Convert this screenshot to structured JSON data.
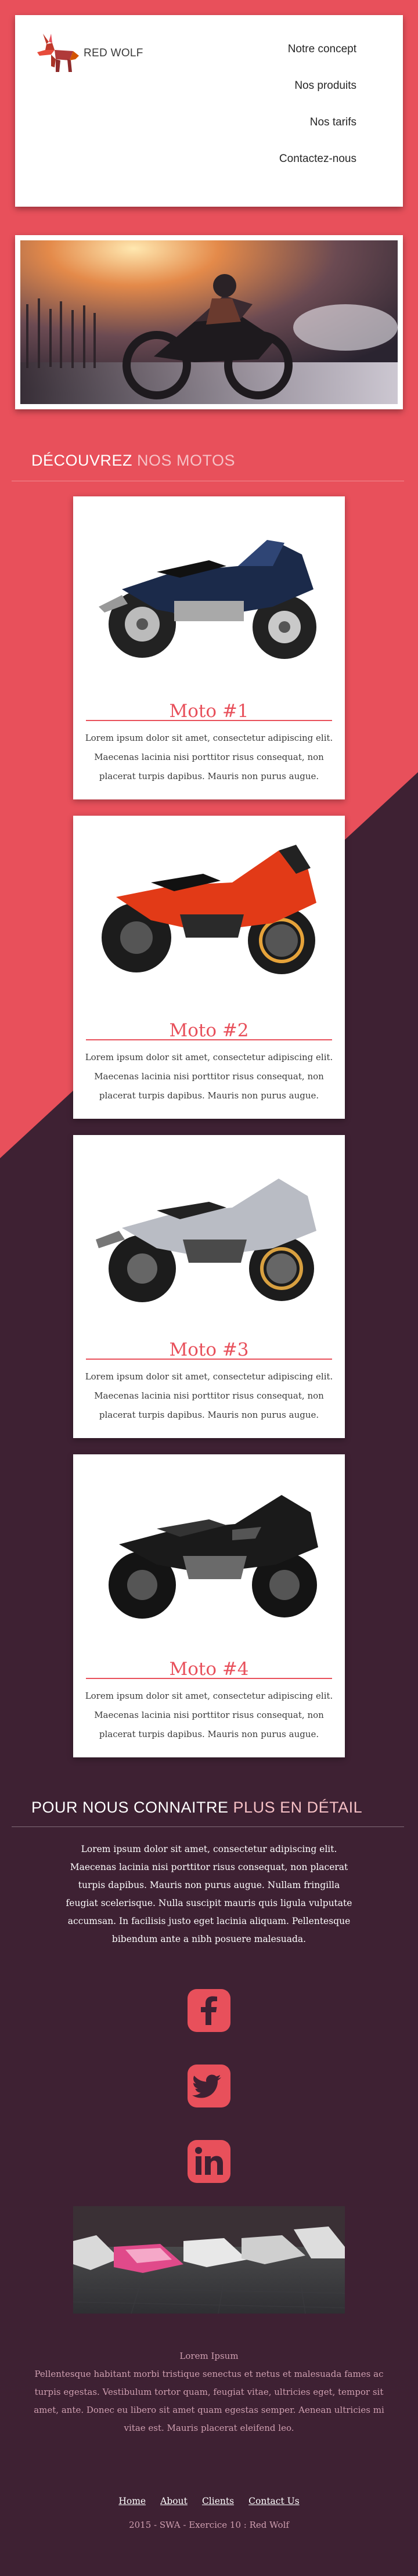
{
  "brand": {
    "name": "RED WOLF"
  },
  "nav": [
    "Notre concept",
    "Nos produits",
    "Nos tarifs",
    "Contactez-nous"
  ],
  "products_section": {
    "title_a": "DÉCOUVREZ",
    "title_b": "NOS MOTOS"
  },
  "products": [
    {
      "title": "Moto #1",
      "text": "Lorem ipsum dolor sit amet, consectetur adipiscing elit. Maecenas lacinia nisi porttitor risus consequat, non placerat turpis dapibus. Mauris non purus augue.",
      "color": "#1b2a4a"
    },
    {
      "title": "Moto #2",
      "text": "Lorem ipsum dolor sit amet, consectetur adipiscing elit. Maecenas lacinia nisi porttitor risus consequat, non placerat turpis dapibus. Mauris non purus augue.",
      "color": "#e23a17"
    },
    {
      "title": "Moto #3",
      "text": "Lorem ipsum dolor sit amet, consectetur adipiscing elit. Maecenas lacinia nisi porttitor risus consequat, non placerat turpis dapibus. Mauris non purus augue.",
      "color": "#b9bcc4"
    },
    {
      "title": "Moto #4",
      "text": "Lorem ipsum dolor sit amet, consectetur adipiscing elit. Maecenas lacinia nisi porttitor risus consequat, non placerat turpis dapibus. Mauris non purus augue.",
      "color": "#1a1a1a"
    }
  ],
  "about_section": {
    "title_a": "POUR NOUS CONNAITRE",
    "title_b": "PLUS EN DÉTAIL",
    "text": "Lorem ipsum dolor sit amet, consectetur adipiscing elit. Maecenas lacinia nisi porttitor risus consequat, non placerat turpis dapibus. Mauris non purus augue. Nullam fringilla feugiat scelerisque. Nulla suscipit mauris quis ligula vulputate accumsan. In facilisis justo eget lacinia aliquam. Pellentesque bibendum ante a nibh posuere malesuada."
  },
  "social": [
    "facebook-icon",
    "twitter-icon",
    "linkedin-icon"
  ],
  "footer": {
    "heading": "Lorem Ipsum",
    "text": "Pellentesque habitant morbi tristique senectus et netus et malesuada fames ac turpis egestas. Vestibulum tortor quam, feugiat vitae, ultricies eget, tempor sit amet, ante. Donec eu libero sit amet quam egestas semper. Aenean ultricies mi vitae est. Mauris placerat eleifend leo.",
    "links": [
      "Home",
      "About",
      "Clients",
      "Contact Us"
    ],
    "copyright": "2015 - SWA - Exercice 10 : Red Wolf"
  },
  "colors": {
    "accent": "#e8505b",
    "dark": "#3e2133",
    "light_text": "#f6c0c5"
  }
}
